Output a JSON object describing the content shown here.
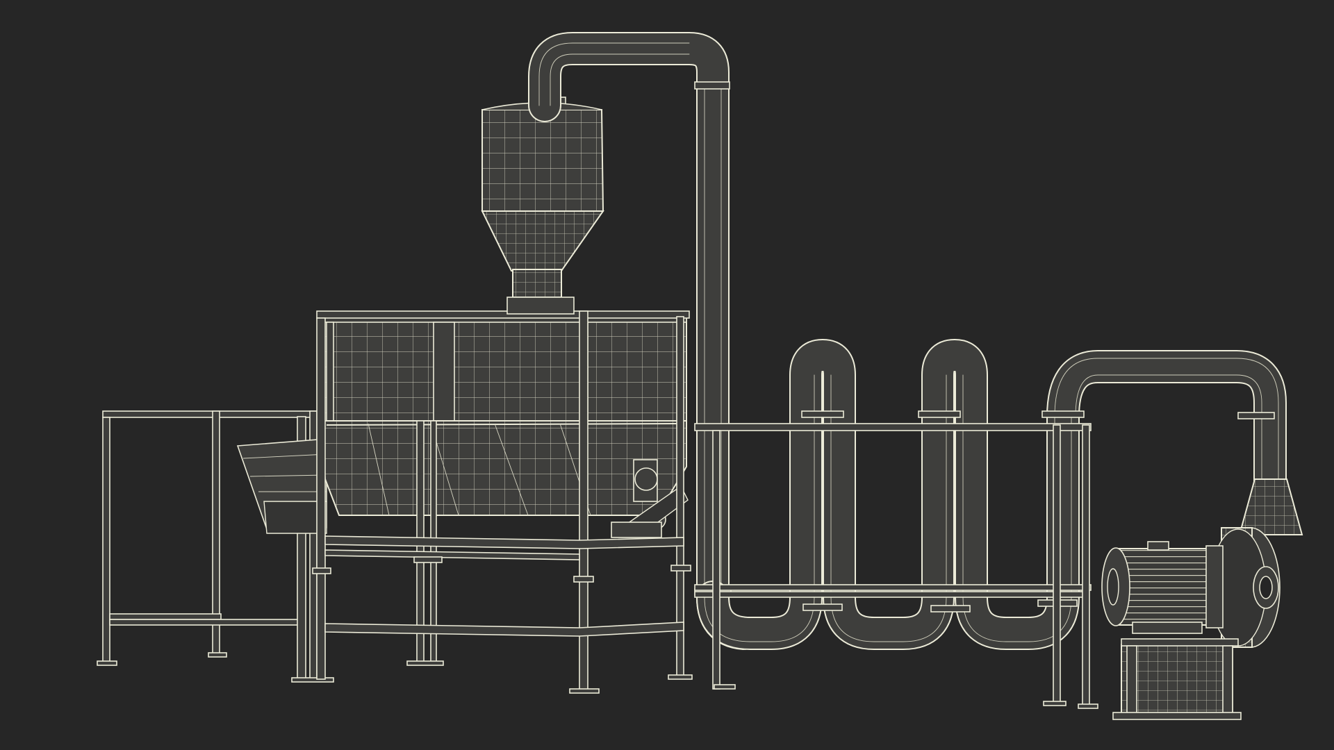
{
  "scene": {
    "subject": "wireframe-industrial-machine",
    "background_color": "#262626",
    "wire_color": "#ecebd8",
    "surface_color": "#3e3e3c"
  }
}
